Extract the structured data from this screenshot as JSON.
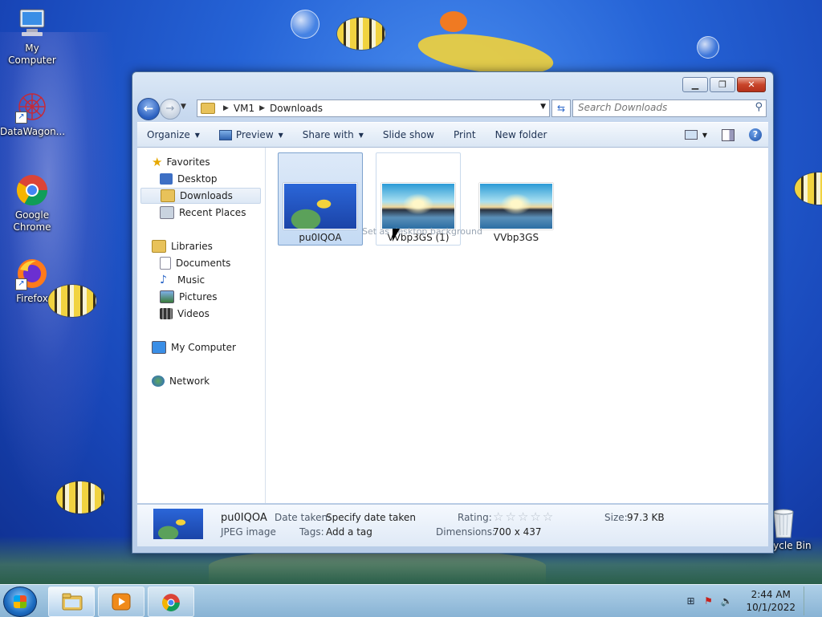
{
  "desktop": {
    "icons": [
      {
        "label": "My Computer"
      },
      {
        "label": "DataWagon..."
      },
      {
        "label": "Google Chrome"
      },
      {
        "label": "Firefox"
      },
      {
        "label": "Recycle Bin"
      }
    ]
  },
  "window": {
    "address": {
      "segments": [
        "VM1",
        "Downloads"
      ]
    },
    "search": {
      "placeholder": "Search Downloads"
    },
    "toolbar": {
      "organize": "Organize",
      "preview": "Preview",
      "share_with": "Share with",
      "slide_show": "Slide show",
      "print": "Print",
      "new_folder": "New folder"
    },
    "nav": {
      "favorites": "Favorites",
      "desktop": "Desktop",
      "downloads": "Downloads",
      "recent_places": "Recent Places",
      "libraries": "Libraries",
      "documents": "Documents",
      "music": "Music",
      "pictures": "Pictures",
      "videos": "Videos",
      "my_computer": "My Computer",
      "network": "Network"
    },
    "files": [
      {
        "name": "pu0IQOA",
        "selected": true
      },
      {
        "name": "VVbp3GS (1)",
        "selected": false
      },
      {
        "name": "VVbp3GS",
        "selected": false
      }
    ],
    "tooltip": "Set as desktop background",
    "details": {
      "name": "pu0IQOA",
      "type": "JPEG image",
      "date_taken_label": "Date taken:",
      "date_taken_value": "Specify date taken",
      "tags_label": "Tags:",
      "tags_value": "Add a tag",
      "rating_label": "Rating:",
      "rating_stars": "☆☆☆☆☆",
      "dimensions_label": "Dimensions:",
      "dimensions_value": "700 x 437",
      "size_label": "Size:",
      "size_value": "97.3 KB"
    }
  },
  "taskbar": {
    "time": "2:44 AM",
    "date": "10/1/2022"
  },
  "colors": {
    "accent": "#2a5fbf",
    "close": "#c8442a",
    "selection": "#c4daf4"
  }
}
